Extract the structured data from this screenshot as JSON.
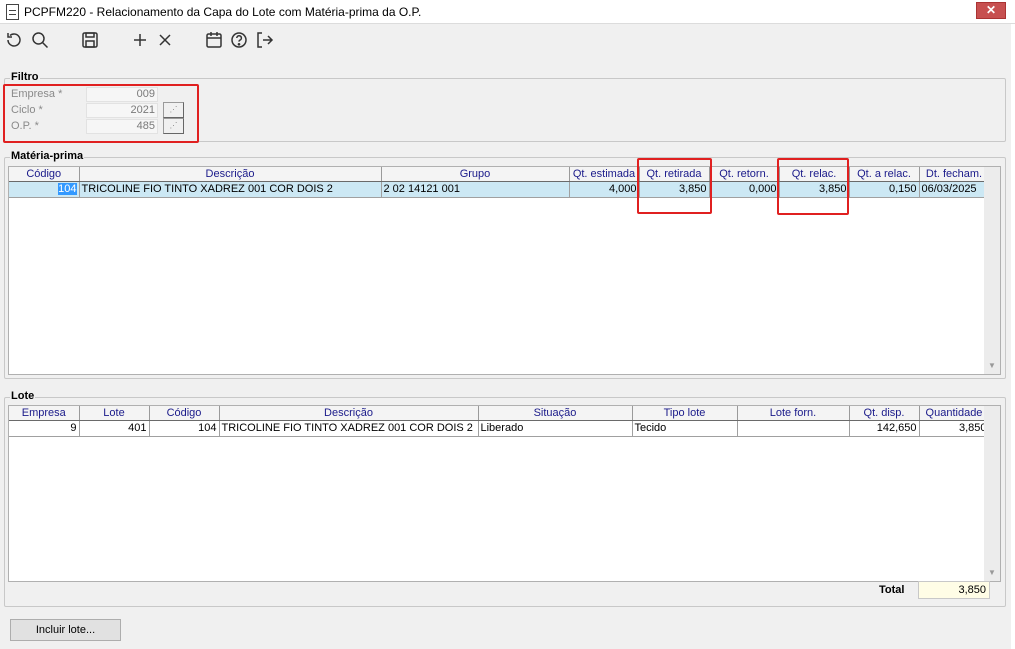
{
  "window": {
    "title": "PCPFM220 - Relacionamento da Capa do Lote com Matéria-prima da O.P.",
    "close": "✕"
  },
  "toolbar": {
    "icons": [
      "undo-icon",
      "search-icon",
      "save-icon",
      "add-icon",
      "delete-icon",
      "calendar-icon",
      "help-icon",
      "exit-icon"
    ]
  },
  "filtro": {
    "title": "Filtro",
    "empresa_label": "Empresa *",
    "empresa_value": "009",
    "ciclo_label": "Ciclo *",
    "ciclo_value": "2021",
    "op_label": "O.P. *",
    "op_value": "485"
  },
  "materia_prima": {
    "title": "Matéria-prima",
    "columns": [
      "Código",
      "Descrição",
      "Grupo",
      "Qt. estimada",
      "Qt. retirada",
      "Qt. retorn.",
      "Qt. relac.",
      "Qt. a relac.",
      "Dt. fecham."
    ],
    "rows": [
      [
        "104",
        "TRICOLINE FIO TINTO XADREZ 001 COR DOIS 2",
        "2 02 14121 001",
        "4,000",
        "3,850",
        "0,000",
        "3,850",
        "0,150",
        "06/03/2025"
      ]
    ]
  },
  "lote": {
    "title": "Lote",
    "columns": [
      "Empresa",
      "Lote",
      "Código",
      "Descrição",
      "Situação",
      "Tipo lote",
      "Lote forn.",
      "Qt. disp.",
      "Quantidade"
    ],
    "rows": [
      [
        "9",
        "401",
        "104",
        "TRICOLINE FIO TINTO XADREZ 001 COR DOIS 2",
        "Liberado",
        "Tecido",
        "",
        "142,650",
        "3,850"
      ]
    ],
    "total_label": "Total",
    "total_value": "3,850"
  },
  "buttons": {
    "incluir_lote": "Incluir lote..."
  },
  "colors": {
    "highlight": "#e02020",
    "selection": "#cce8f4",
    "header_text": "#1a1a8a"
  }
}
